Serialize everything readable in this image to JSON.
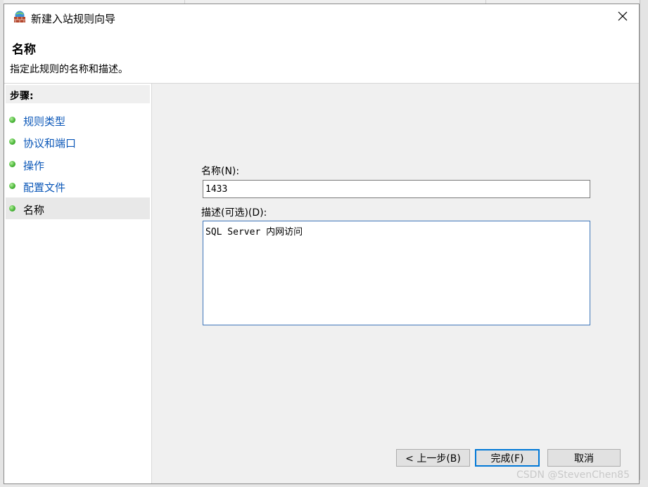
{
  "window": {
    "title": "新建入站规则向导"
  },
  "header": {
    "title": "名称",
    "description": "指定此规则的名称和描述。"
  },
  "steps": {
    "heading": "步骤:",
    "items": [
      {
        "label": "规则类型"
      },
      {
        "label": "协议和端口"
      },
      {
        "label": "操作"
      },
      {
        "label": "配置文件"
      },
      {
        "label": "名称"
      }
    ]
  },
  "form": {
    "name_label": "名称(N):",
    "name_value": "1433",
    "description_label": "描述(可选)(D):",
    "description_value": "SQL Server 内网访问"
  },
  "buttons": {
    "back": "< 上一步(B)",
    "finish": "完成(F)",
    "cancel": "取消"
  },
  "watermark": "CSDN @StevenChen85",
  "colors": {
    "link": "#0b57b8",
    "step_dot": "#4cb83a",
    "focus_border": "#0078d7"
  },
  "icons": {
    "app": "firewall-icon",
    "close": "close-icon",
    "step": "green-dot-icon"
  }
}
